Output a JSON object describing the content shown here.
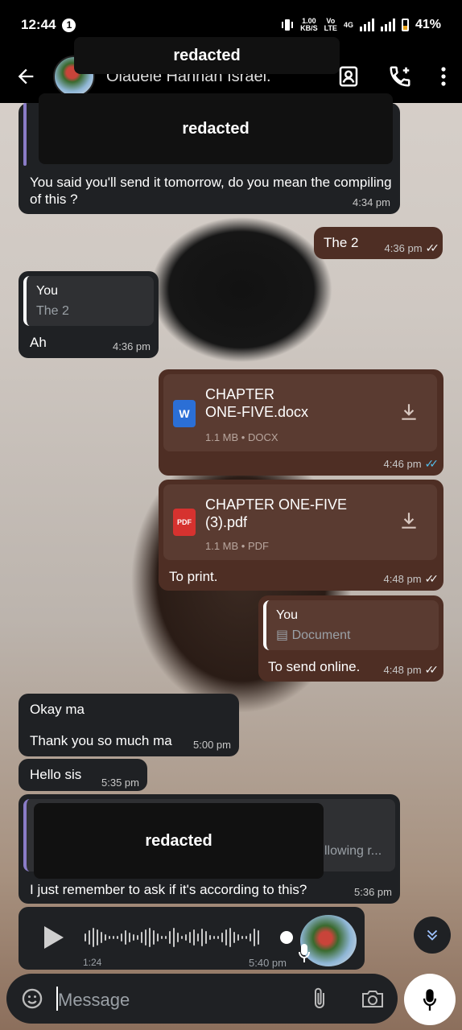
{
  "status_bar": {
    "time": "12:44",
    "notification_badge": "1",
    "speed_value": "1.00",
    "speed_unit": "KB/S",
    "volte_top": "Vo",
    "volte_bottom": "LTE",
    "network": "4G",
    "battery": "41%"
  },
  "header": {
    "contact_name": "Oladele Hannah Israel.",
    "redaction_label": "redacted"
  },
  "messages": {
    "m1": {
      "redaction_label": "redacted",
      "text": "You said you'll send it tomorrow, do you mean the compiling of this ?",
      "time": "4:34 pm"
    },
    "m2": {
      "text": "The 2",
      "time": "4:36 pm"
    },
    "m3": {
      "quote_name": "You",
      "quote_text": "The 2",
      "text": "Ah",
      "time": "4:36 pm"
    },
    "m4": {
      "title_line1": "CHAPTER",
      "title_line2": "ONE-FIVE.docx",
      "meta": "1.1 MB • DOCX",
      "icon_letter": "W",
      "time": "4:46 pm"
    },
    "m5": {
      "title_line1": "CHAPTER ONE-FIVE",
      "title_line2": "(3).pdf",
      "meta": "1.1 MB • PDF",
      "icon_letter": "PDF",
      "caption": "To print.",
      "time": "4:48 pm"
    },
    "m6": {
      "quote_name": "You",
      "quote_text": "Document",
      "text": "To send online.",
      "time": "4:48 pm"
    },
    "m7": {
      "line1": "Okay ma",
      "line2": "Thank you so much ma",
      "time": "5:00 pm"
    },
    "m8": {
      "text": "Hello sis",
      "time": "5:35 pm"
    },
    "m9": {
      "redaction_label": "redacted",
      "quote_tail": "llowing r...",
      "text": "I just remember to ask if it's according to this?",
      "time": "5:36 pm"
    },
    "m10": {
      "duration": "1:24",
      "time": "5:40 pm"
    }
  },
  "input": {
    "placeholder": "Message"
  },
  "colors": {
    "incoming_bubble": "#1f2124",
    "outgoing_bubble": "#4e2e24",
    "read_tick_blue": "#53bdeb",
    "word_icon": "#2b6fd6",
    "pdf_icon": "#d6322f"
  },
  "icons": [
    "back-arrow-icon",
    "add-contact-icon",
    "add-call-icon",
    "more-vert-icon",
    "download-icon",
    "play-icon",
    "sticker-icon",
    "attach-icon",
    "camera-icon",
    "mic-icon",
    "scroll-down-icon"
  ]
}
